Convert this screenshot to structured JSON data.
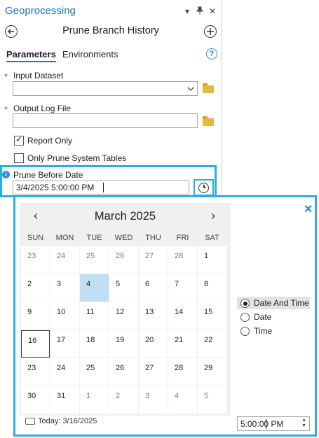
{
  "pane": {
    "title": "Geoprocessing",
    "window_buttons": [
      "▾",
      "⊥",
      "✕"
    ],
    "tool_title": "Prune Branch History",
    "back_icon": "back-arrow-icon",
    "add_icon": "add-circle-icon",
    "tabs": {
      "parameters": "Parameters",
      "environments": "Environments"
    },
    "help_glyph": "?"
  },
  "params": {
    "required_mark": "*",
    "input_dataset": {
      "label": "Input Dataset",
      "value": ""
    },
    "output_log": {
      "label": "Output Log File",
      "value": ""
    },
    "report_only": {
      "label": "Report Only",
      "checked": true
    },
    "only_system": {
      "label": "Only Prune System Tables",
      "checked": false
    },
    "prune_date": {
      "label": "Prune Before Date",
      "value": "3/4/2025 5:00:00 PM",
      "info_glyph": "i"
    }
  },
  "calendar": {
    "month": "March 2025",
    "prev": "‹",
    "next": "›",
    "close": "✕",
    "weekdays": [
      "SUN",
      "MON",
      "TUE",
      "WED",
      "THU",
      "FRI",
      "SAT"
    ],
    "weeks": [
      [
        {
          "d": "23",
          "o": true
        },
        {
          "d": "24",
          "o": true
        },
        {
          "d": "25",
          "o": true
        },
        {
          "d": "26",
          "o": true
        },
        {
          "d": "27",
          "o": true
        },
        {
          "d": "28",
          "o": true
        },
        {
          "d": "1"
        }
      ],
      [
        {
          "d": "2"
        },
        {
          "d": "3"
        },
        {
          "d": "4",
          "sel": true
        },
        {
          "d": "5"
        },
        {
          "d": "6"
        },
        {
          "d": "7"
        },
        {
          "d": "8"
        }
      ],
      [
        {
          "d": "9"
        },
        {
          "d": "10"
        },
        {
          "d": "11"
        },
        {
          "d": "12"
        },
        {
          "d": "13"
        },
        {
          "d": "14"
        },
        {
          "d": "15"
        }
      ],
      [
        {
          "d": "16",
          "today": true
        },
        {
          "d": "17"
        },
        {
          "d": "18"
        },
        {
          "d": "19"
        },
        {
          "d": "20"
        },
        {
          "d": "21"
        },
        {
          "d": "22"
        }
      ],
      [
        {
          "d": "23"
        },
        {
          "d": "24"
        },
        {
          "d": "25"
        },
        {
          "d": "26"
        },
        {
          "d": "27"
        },
        {
          "d": "28"
        },
        {
          "d": "29"
        }
      ],
      [
        {
          "d": "30"
        },
        {
          "d": "31"
        },
        {
          "d": "1",
          "o": true
        },
        {
          "d": "2",
          "o": true
        },
        {
          "d": "3",
          "o": true
        },
        {
          "d": "4",
          "o": true
        },
        {
          "d": "5",
          "o": true
        }
      ]
    ],
    "today_label": "Today: 3/16/2025",
    "modes": [
      {
        "label": "Date And Time",
        "selected": true
      },
      {
        "label": "Date",
        "selected": false
      },
      {
        "label": "Time",
        "selected": false
      }
    ],
    "time_value": "5:00:00 PM"
  },
  "colors": {
    "accent": "#28aee0",
    "title_blue": "#1f77c0",
    "selected_day": "#bfe0f4",
    "required": "#e0312b"
  }
}
